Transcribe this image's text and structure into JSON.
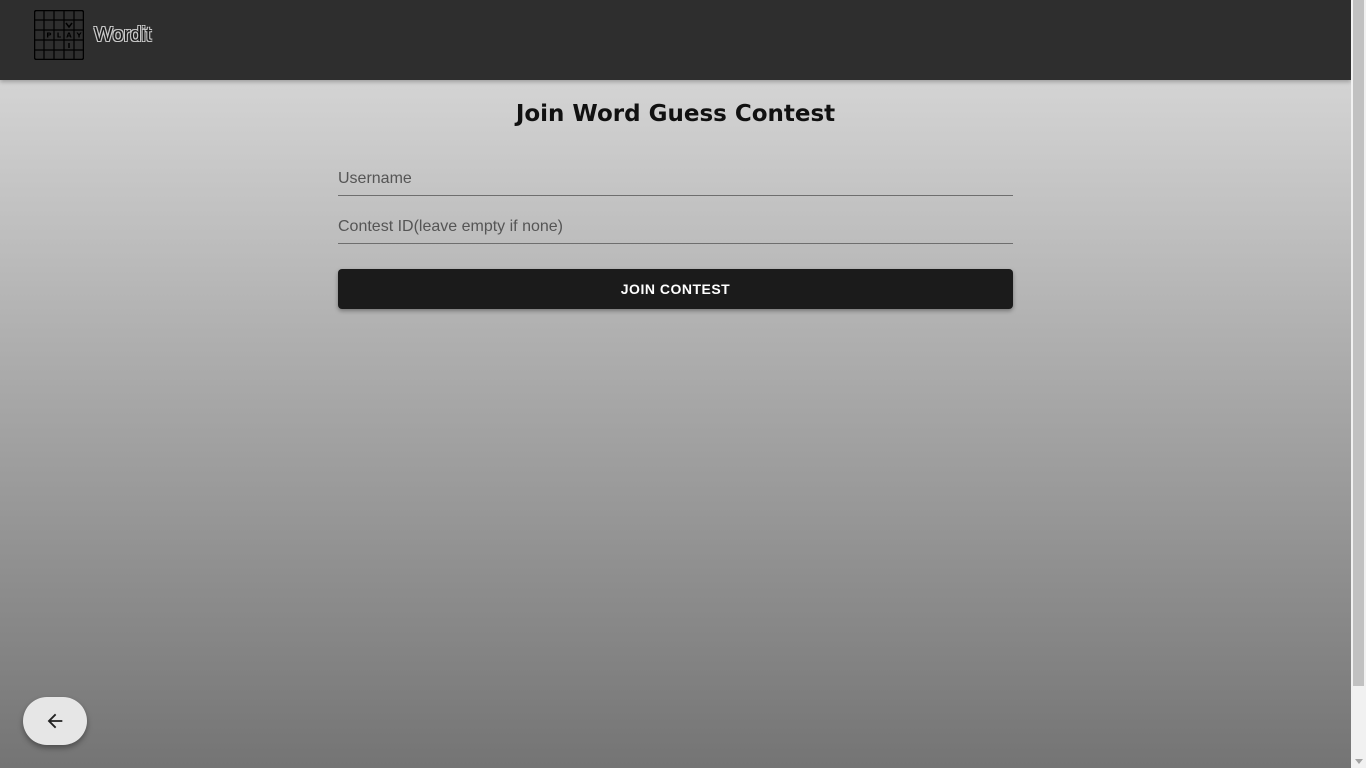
{
  "header": {
    "brand": "Wordit",
    "logo_letters": [
      "P",
      "L",
      "A",
      "Y"
    ]
  },
  "main": {
    "title": "Join Word Guess Contest",
    "username_placeholder": "Username",
    "contest_placeholder": "Contest ID(leave empty if none)",
    "join_label": "JOIN CONTEST"
  },
  "fab": {
    "icon": "arrow-left-icon"
  },
  "colors": {
    "appbar": "#2e2e2e",
    "button": "#1b1b1b",
    "fab": "#e6e6e6",
    "gradient_top": "#d4d4d4",
    "gradient_bottom": "#747474"
  }
}
